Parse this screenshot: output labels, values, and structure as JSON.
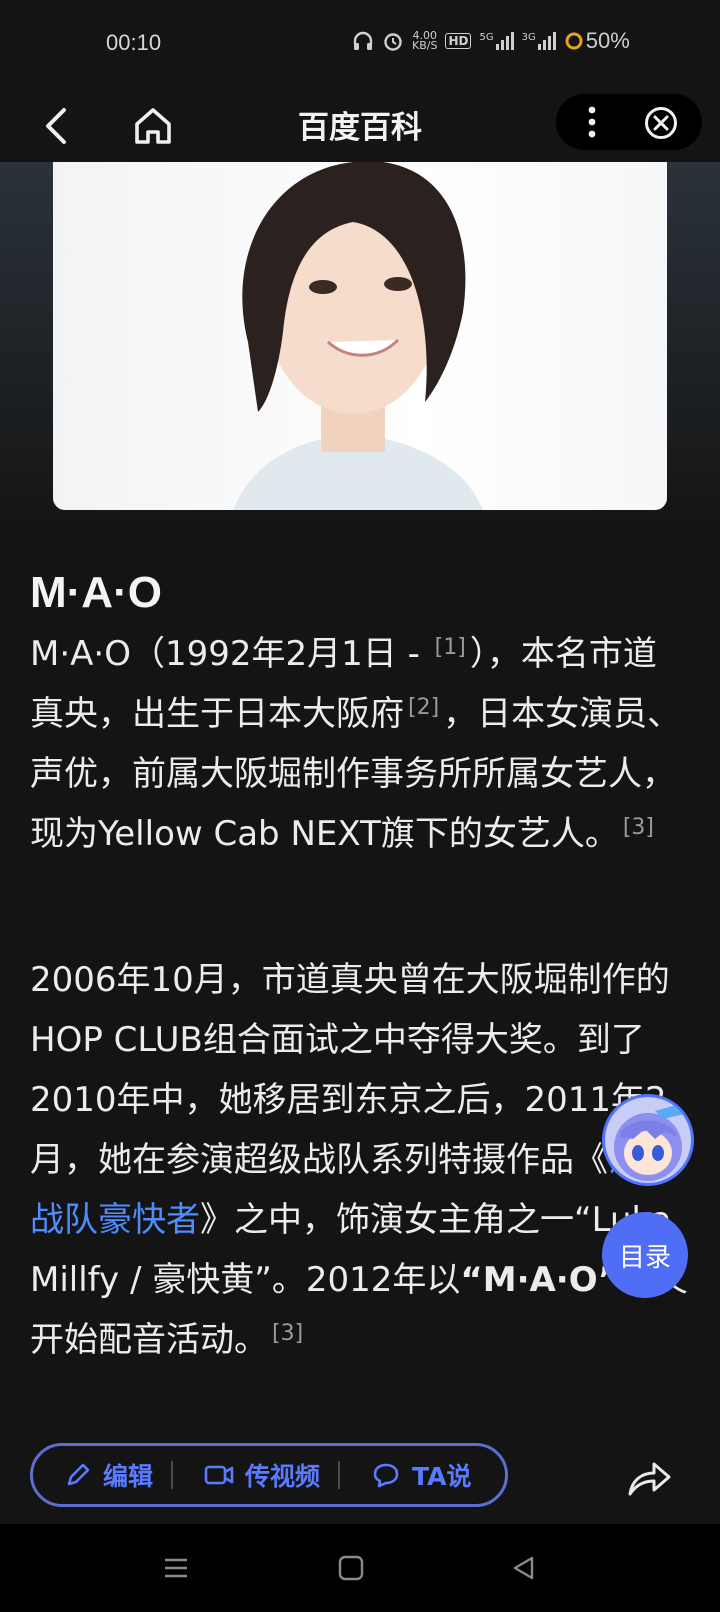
{
  "status": {
    "time": "00:10",
    "speed_top": "4.00",
    "speed_bottom": "KB/S",
    "hd": "HD",
    "net1": "5G",
    "net2": "3G",
    "battery": "50%"
  },
  "header": {
    "title": "百度百科"
  },
  "article": {
    "name": "M·A·O",
    "p1": {
      "t1": "M·A·O（1992年2月1日 - ",
      "r1": "[1]",
      "t2": "），本名市道真央，出生于日本大阪府",
      "r2": "[2]",
      "t3": "，日本女演员、声优，前属大阪堀制作事务所所属女艺人，现为Yellow Cab NEXT旗下的女艺人。",
      "r3": "[3]"
    },
    "p2": {
      "t1": "2006年10月，市道真央曾在大阪堀制作的HOP CLUB组合面试之中夺得大奖。到了2010年中，她移居到东京之后，2011年2月，她在参演超级战队系列特摄作品《",
      "link": "海贼战队豪快者",
      "t2": "》之中，饰演女主角之一“Luka Millfy / 豪快黄”。2012年以",
      "bold": "“M·A·O”",
      "t3": "名义开始配音活动。",
      "r": "[3]"
    }
  },
  "floating": {
    "toc_label": "目录"
  },
  "toolbar": {
    "edit": "编辑",
    "video": "传视频",
    "ta": "TA说"
  },
  "colors": {
    "accent": "#4f6df5",
    "link": "#4e8dff",
    "background": "#141414"
  }
}
